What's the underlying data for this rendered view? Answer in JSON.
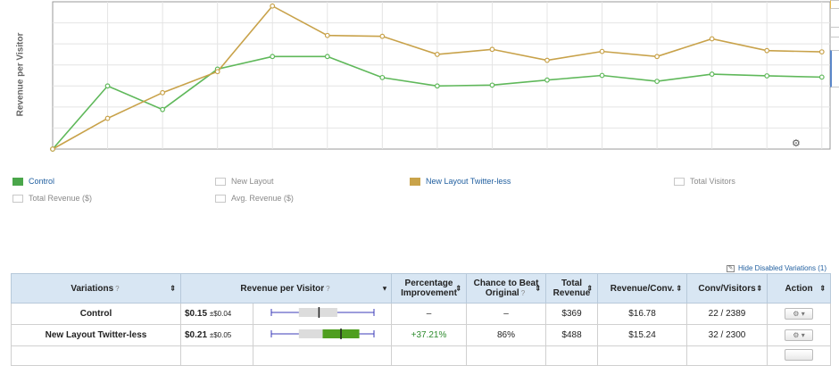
{
  "chart_data": {
    "type": "line",
    "ylabel": "Revenue per Visitor",
    "xlabel": "",
    "x": [
      1,
      2,
      3,
      4,
      5,
      6,
      7,
      8,
      9,
      10,
      11,
      12,
      13,
      14,
      15
    ],
    "ylim": [
      0,
      0.35
    ],
    "grid": true,
    "series": [
      {
        "name": "Control",
        "color": "#5fb85a",
        "values": [
          0.0,
          0.15,
          0.094,
          0.19,
          0.22,
          0.22,
          0.17,
          0.15,
          0.152,
          0.164,
          0.175,
          0.161,
          0.178,
          0.174,
          0.171
        ]
      },
      {
        "name": "New Layout Twitter-less",
        "color": "#c8a24a",
        "values": [
          0.0,
          0.073,
          0.134,
          0.184,
          0.34,
          0.27,
          0.268,
          0.225,
          0.237,
          0.211,
          0.232,
          0.22,
          0.262,
          0.234,
          0.231
        ]
      }
    ]
  },
  "legend": [
    {
      "label": "Control",
      "active": true,
      "color": "#4aa64a"
    },
    {
      "label": "New Layout",
      "active": false,
      "color": "#ffffff"
    },
    {
      "label": "New Layout Twitter-less",
      "active": true,
      "color": "#c9a34a"
    },
    {
      "label": "Total Visitors",
      "active": false,
      "color": "#ffffff"
    },
    {
      "label": "Total Revenue ($)",
      "active": false,
      "color": "#ffffff"
    },
    {
      "label": "Avg. Revenue ($)",
      "active": false,
      "color": "#ffffff"
    }
  ],
  "settings_icon": "gear-icon",
  "hide_disabled_label": "Hide Disabled Variations (1)",
  "table": {
    "headers": {
      "variations": "Variations",
      "rpv": "Revenue per Visitor",
      "pct_line1": "Percentage",
      "pct_line2": "Improvement",
      "chance_line1": "Chance to Beat",
      "chance_line2": "Original",
      "total_line1": "Total",
      "total_line2": "Revenue",
      "rev_conv": "Revenue/Conv.",
      "conv_visitors": "Conv/Visitors",
      "action": "Action"
    },
    "help_mark": "?",
    "sort_glyph": "⇕",
    "rows": [
      {
        "name": "Control",
        "rpv": "$0.15",
        "pm": "±$0.04",
        "pct": "–",
        "chance": "–",
        "total": "$369",
        "rev_conv": "$16.78",
        "conv": "22 / 2389",
        "action": "⚙ ▾",
        "box": {
          "low": 0.11,
          "high": 0.19,
          "mean": 0.15,
          "improved": false
        }
      },
      {
        "name": "New Layout Twitter-less",
        "rpv": "$0.21",
        "pm": "±$0.05",
        "pct": "+37.21%",
        "chance": "86%",
        "total": "$488",
        "rev_conv": "$15.24",
        "conv": "32 / 2300",
        "action": "⚙ ▾",
        "box": {
          "low": 0.16,
          "high": 0.26,
          "mean": 0.21,
          "improved": true
        }
      }
    ]
  }
}
